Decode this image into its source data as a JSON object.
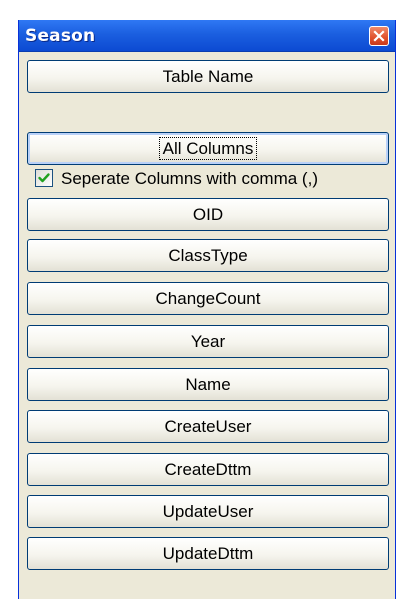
{
  "window": {
    "title": "Season",
    "close_icon": "close-icon",
    "colors": {
      "titlebar": "#0c4ad2",
      "close_button": "#e0512c",
      "face": "#ece9d8",
      "check_mark": "#21a121"
    }
  },
  "buttons": {
    "table_name": "Table Name",
    "all_columns": "All Columns"
  },
  "options": {
    "separate_columns_label": "Seperate Columns with comma (,)",
    "separate_columns_checked": true
  },
  "columns": [
    "OID",
    "ClassType",
    "ChangeCount",
    "Year",
    "Name",
    "CreateUser",
    "CreateDttm",
    "UpdateUser",
    "UpdateDttm"
  ]
}
